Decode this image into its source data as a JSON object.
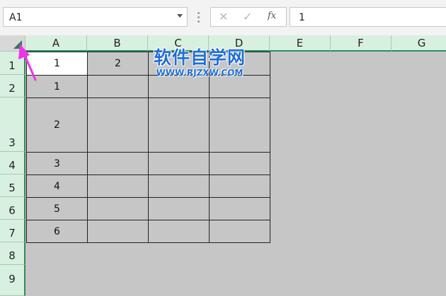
{
  "formula_bar": {
    "name_box": "A1",
    "cancel_glyph": "✕",
    "enter_glyph": "✓",
    "fx_label": "fx",
    "formula_value": "1"
  },
  "columns": [
    "A",
    "B",
    "C",
    "D",
    "E",
    "F",
    "G"
  ],
  "rows": [
    "1",
    "2",
    "3",
    "4",
    "5",
    "6",
    "7",
    "8",
    "9"
  ],
  "cells": {
    "a1": "1",
    "b1": "2",
    "a2": "1",
    "a3": "2",
    "a4": "3",
    "a5": "4",
    "a6": "5",
    "a7": "6"
  },
  "watermark": {
    "title": "软件自学网",
    "url": "WWW.RJZXW.COM"
  },
  "colors": {
    "header_bg": "#d8f0e0",
    "accent": "#2f8a5a",
    "arrow": "#ee33ee",
    "watermark": "#1f6fd4",
    "sheet_bg": "#c6c6c6"
  },
  "icons": {
    "select_all": "select-all-triangle-icon",
    "dropdown": "chevron-down-icon",
    "annotation": "arrow-pointer-icon"
  }
}
